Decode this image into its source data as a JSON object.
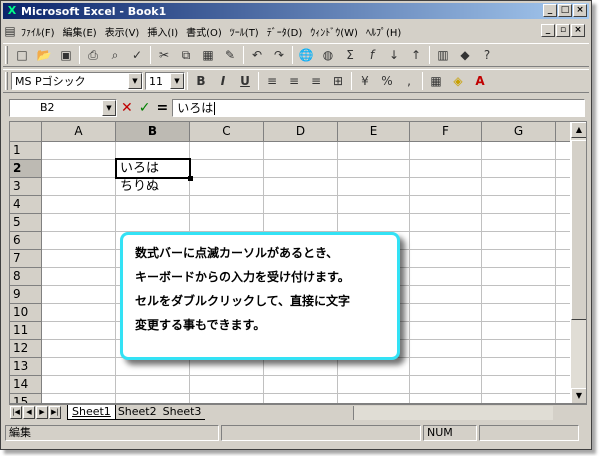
{
  "window": {
    "title": "Microsoft Excel - Book1"
  },
  "menu": [
    "ﾌｧｲﾙ(F)",
    "編集(E)",
    "表示(V)",
    "挿入(I)",
    "書式(O)",
    "ﾂｰﾙ(T)",
    "ﾃﾞｰﾀ(D)",
    "ｳｨﾝﾄﾞｳ(W)",
    "ﾍﾙﾌﾟ(H)"
  ],
  "formatting": {
    "font_name": "MS Pゴシック",
    "font_size": "11"
  },
  "formula_bar": {
    "name_box": "B2",
    "equals": "=",
    "value": "いろは"
  },
  "columns": [
    "A",
    "B",
    "C",
    "D",
    "E",
    "F",
    "G"
  ],
  "rows": [
    "1",
    "2",
    "3",
    "4",
    "5",
    "6",
    "7",
    "8",
    "9",
    "10",
    "11",
    "12",
    "13",
    "14",
    "15"
  ],
  "cells": {
    "B2": "いろは",
    "B3": "ちりぬ"
  },
  "sheets": [
    "Sheet1",
    "Sheet2",
    "Sheet3"
  ],
  "status": {
    "mode": "編集",
    "num": "NUM"
  },
  "callout": {
    "line1": "数式バーに点滅カーソルがあるとき、",
    "line2": "キーボードからの入力を受け付けます。",
    "line3": "セルをダブルクリックして、直接に文字",
    "line4": "変更する事もできます。"
  },
  "colors": {
    "callout_border": "#33e2f5",
    "title_start": "#0a246a"
  }
}
